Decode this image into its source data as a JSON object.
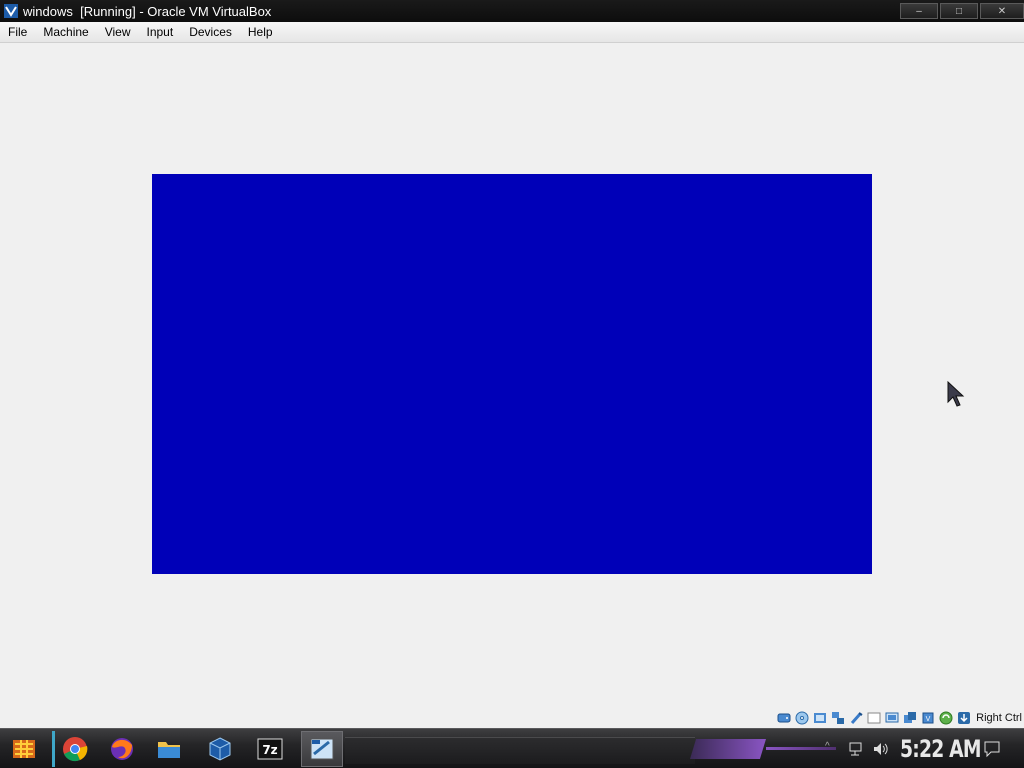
{
  "window": {
    "title": "windows  [Running] - Oracle VM VirtualBox",
    "minimize_label": "–",
    "maximize_label": "□",
    "close_label": "✕"
  },
  "menu": [
    "File",
    "Machine",
    "View",
    "Input",
    "Devices",
    "Help"
  ],
  "vm_screen": {
    "color": "#0000b8"
  },
  "status_bar": {
    "icons": [
      "hard-disk-icon",
      "optical-drive-icon",
      "audio-icon",
      "network-icon",
      "usb-icon",
      "shared-folders-icon",
      "display-icon",
      "video-capture-icon",
      "cpu-icon",
      "mouse-integration-icon",
      "host-key-icon"
    ],
    "host_key": "Right Ctrl"
  },
  "taskbar": {
    "apps": [
      "start-icon",
      "chrome-icon",
      "firefox-icon",
      "file-explorer-icon",
      "virtualbox-icon",
      "7zip-icon",
      "settings-icon"
    ],
    "clock": "5:22 AM"
  }
}
